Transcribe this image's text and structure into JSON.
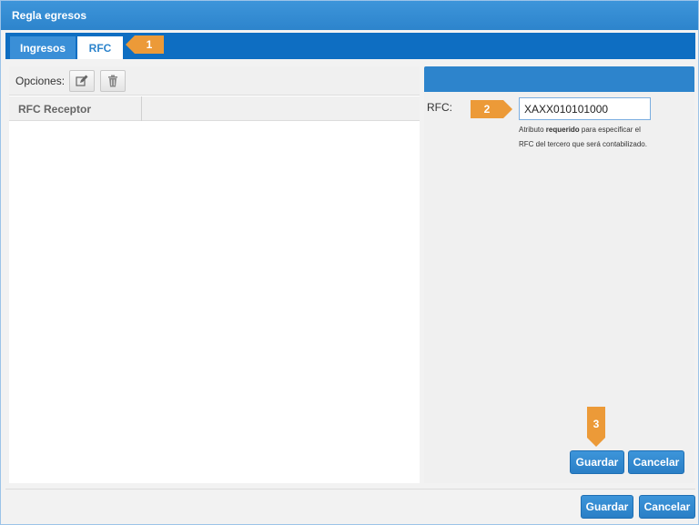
{
  "window": {
    "title": "Regla egresos"
  },
  "tabs": [
    {
      "label": "Ingresos"
    },
    {
      "label": "RFC"
    }
  ],
  "toolbar": {
    "opciones_label": "Opciones:",
    "edit_icon": "pencil-icon",
    "delete_icon": "trash-icon"
  },
  "grid": {
    "columns": [
      "RFC Receptor"
    ],
    "rows": []
  },
  "form": {
    "rfc_label": "RFC:",
    "rfc_value": "XAXX010101000",
    "hint_prefix": "Atributo ",
    "hint_bold": "requerido",
    "hint_suffix": " para especificar el RFC del tercero que será contabilizado.",
    "guardar_label": "Guardar",
    "cancelar_label": "Cancelar"
  },
  "footer": {
    "guardar_label": "Guardar",
    "cancelar_label": "Cancelar"
  },
  "callouts": [
    "1",
    "2",
    "3"
  ],
  "colors": {
    "primary": "#2d84cc",
    "tabstrip": "#0e6ec2",
    "callout": "#ec9a38"
  }
}
